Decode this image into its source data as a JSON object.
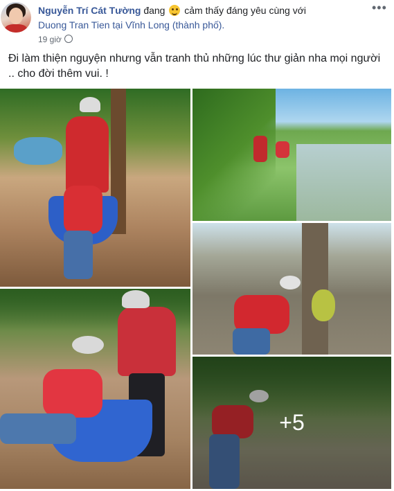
{
  "post": {
    "author": "Nguyễn Trí Cát Tường",
    "feeling_prefix": "đang",
    "feeling_text": "cảm thấy đáng yêu cùng với",
    "tagged": "Duong Tran Tien",
    "location_prefix": "tại",
    "location": "Vĩnh Long (thành phố).",
    "time": "19 giờ",
    "more_label": "•••",
    "caption": "Đi làm thiện nguyện nhưng vẫn tranh thủ những lúc thư giản nha mọi người .. cho đời thêm vui. !",
    "more_photos": "+5"
  },
  "colors": {
    "link": "#385898",
    "text": "#1c1e21",
    "muted": "#606770"
  },
  "icons": {
    "emoji": "smiling-face-icon",
    "privacy": "globe-icon",
    "menu": "more-options-icon"
  }
}
